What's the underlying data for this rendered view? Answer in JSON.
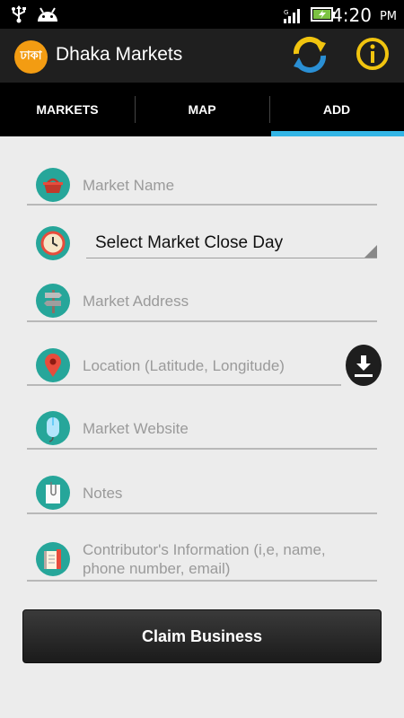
{
  "status_bar": {
    "time": "4:20",
    "ampm": "PM"
  },
  "action_bar": {
    "logo_text": "ঢাকা",
    "title": "Dhaka Markets"
  },
  "tabs": [
    {
      "label": "MARKETS",
      "active": false
    },
    {
      "label": "MAP",
      "active": false
    },
    {
      "label": "ADD",
      "active": true
    }
  ],
  "form": {
    "market_name": {
      "placeholder": "Market Name",
      "icon": "basket-icon"
    },
    "close_day": {
      "value": "Select Market Close Day",
      "icon": "clock-icon"
    },
    "market_address": {
      "placeholder": "Market Address",
      "icon": "signpost-icon"
    },
    "location": {
      "placeholder": "Location (Latitude, Longitude)",
      "icon": "map-pin-icon"
    },
    "market_website": {
      "placeholder": "Market Website",
      "icon": "mouse-icon"
    },
    "notes": {
      "placeholder": "Notes",
      "icon": "notepad-icon"
    },
    "contributor": {
      "placeholder": "Contributor's Information (i,e, name, phone number, email)",
      "icon": "contact-book-icon"
    }
  },
  "claim_button": {
    "label": "Claim Business"
  },
  "colors": {
    "accent": "#33b5e5",
    "icon_bg": "#26a69a",
    "logo": "#f39c12",
    "refresh": "#f1c40f",
    "info": "#f1c40f"
  }
}
